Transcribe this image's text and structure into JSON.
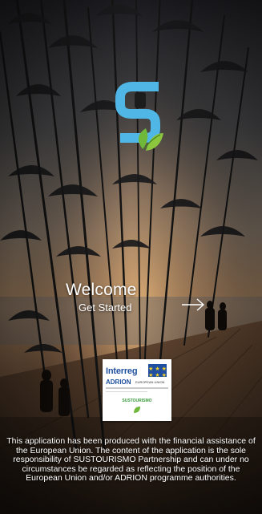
{
  "welcome": {
    "title": "Welcome",
    "subtitle": "Get Started"
  },
  "interreg_card": {
    "title": "Interreg",
    "program": "ADRION",
    "fund_text": "EUROPEAN UNION",
    "project": "SUSTOURISMO"
  },
  "disclaimer": "This application has been produced with the financial assistance of the European Union. The content of the application is the sole responsibility of SUSTOURISMO Partnership and can under no circumstances be regarded as reflecting the position of the European Union and/or ADRION programme authorities.",
  "icons": {
    "logo": "sustourismo-logo-icon",
    "arrow": "arrow-right-icon",
    "eu_flag": "eu-flag-icon",
    "leaf": "leaf-icon"
  },
  "colors": {
    "logo_blue": "#4fb6e6",
    "logo_green": "#6fb83a",
    "interreg_blue": "#1f4f9e",
    "text": "#ffffff"
  }
}
